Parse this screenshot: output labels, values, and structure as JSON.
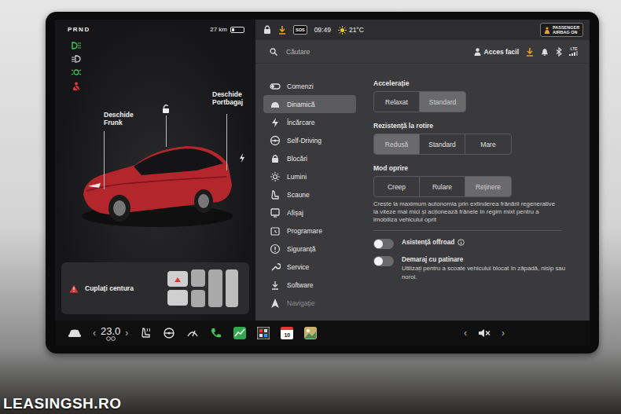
{
  "status": {
    "gear": "PRND",
    "range": "27 km",
    "battery_level": 0.2,
    "sos": "SOS",
    "time": "09:49",
    "temperature": "21°C",
    "airbag_badge": "PASSENGER AIRBAG ON"
  },
  "car": {
    "frunk_label": "Deschide Frunk",
    "trunk_label": "Deschide Portbagaj",
    "seatbelt_warning": "Cuplați centura"
  },
  "search": {
    "placeholder": "Căutare"
  },
  "profile": {
    "label": "Acces facil"
  },
  "signal": {
    "label": "LTE"
  },
  "menu": [
    {
      "label": "Comenzi",
      "selected": false,
      "faded": false
    },
    {
      "label": "Dinamică",
      "selected": true,
      "faded": false
    },
    {
      "label": "Încărcare",
      "selected": false,
      "faded": false
    },
    {
      "label": "Self-Driving",
      "selected": false,
      "faded": false
    },
    {
      "label": "Blocări",
      "selected": false,
      "faded": false
    },
    {
      "label": "Lumini",
      "selected": false,
      "faded": false
    },
    {
      "label": "Scaune",
      "selected": false,
      "faded": false
    },
    {
      "label": "Afișaj",
      "selected": false,
      "faded": false
    },
    {
      "label": "Programare",
      "selected": false,
      "faded": false
    },
    {
      "label": "Siguranță",
      "selected": false,
      "faded": false
    },
    {
      "label": "Service",
      "selected": false,
      "faded": false
    },
    {
      "label": "Software",
      "selected": false,
      "faded": false
    },
    {
      "label": "Navigație",
      "selected": false,
      "faded": true
    }
  ],
  "settings": {
    "groups": [
      {
        "title": "Accelerație",
        "options": [
          {
            "label": "Relaxat",
            "selected": false
          },
          {
            "label": "Standard",
            "selected": true
          }
        ]
      },
      {
        "title": "Rezistență la rotire",
        "options": [
          {
            "label": "Redusă",
            "selected": true
          },
          {
            "label": "Standard",
            "selected": false
          },
          {
            "label": "Mare",
            "selected": false
          }
        ]
      },
      {
        "title": "Mod oprire",
        "options": [
          {
            "label": "Creep",
            "selected": false
          },
          {
            "label": "Rulare",
            "selected": false
          },
          {
            "label": "Reținere",
            "selected": true
          }
        ]
      }
    ],
    "description": "Crește la maximum autonomia prin extinderea frânării regenerative la viteze mai mici și acționează frânele în regim mixt pentru a imobiliza vehiculul oprit"
  },
  "toggles": [
    {
      "label": "Asistență offroad",
      "on": false,
      "description": ""
    },
    {
      "label": "Demaraj cu patinare",
      "on": false,
      "description": "Utilizați pentru a scoate vehiculul blocat în zăpadă, nisip sau noroi."
    }
  ],
  "bottom_bar": {
    "temp_down": "‹",
    "cabin_temp": "23.0",
    "temp_up": "›",
    "calendar_day": "10",
    "volume_down": "‹",
    "volume_up": "›"
  },
  "watermark": "LEASINGSH.RO"
}
